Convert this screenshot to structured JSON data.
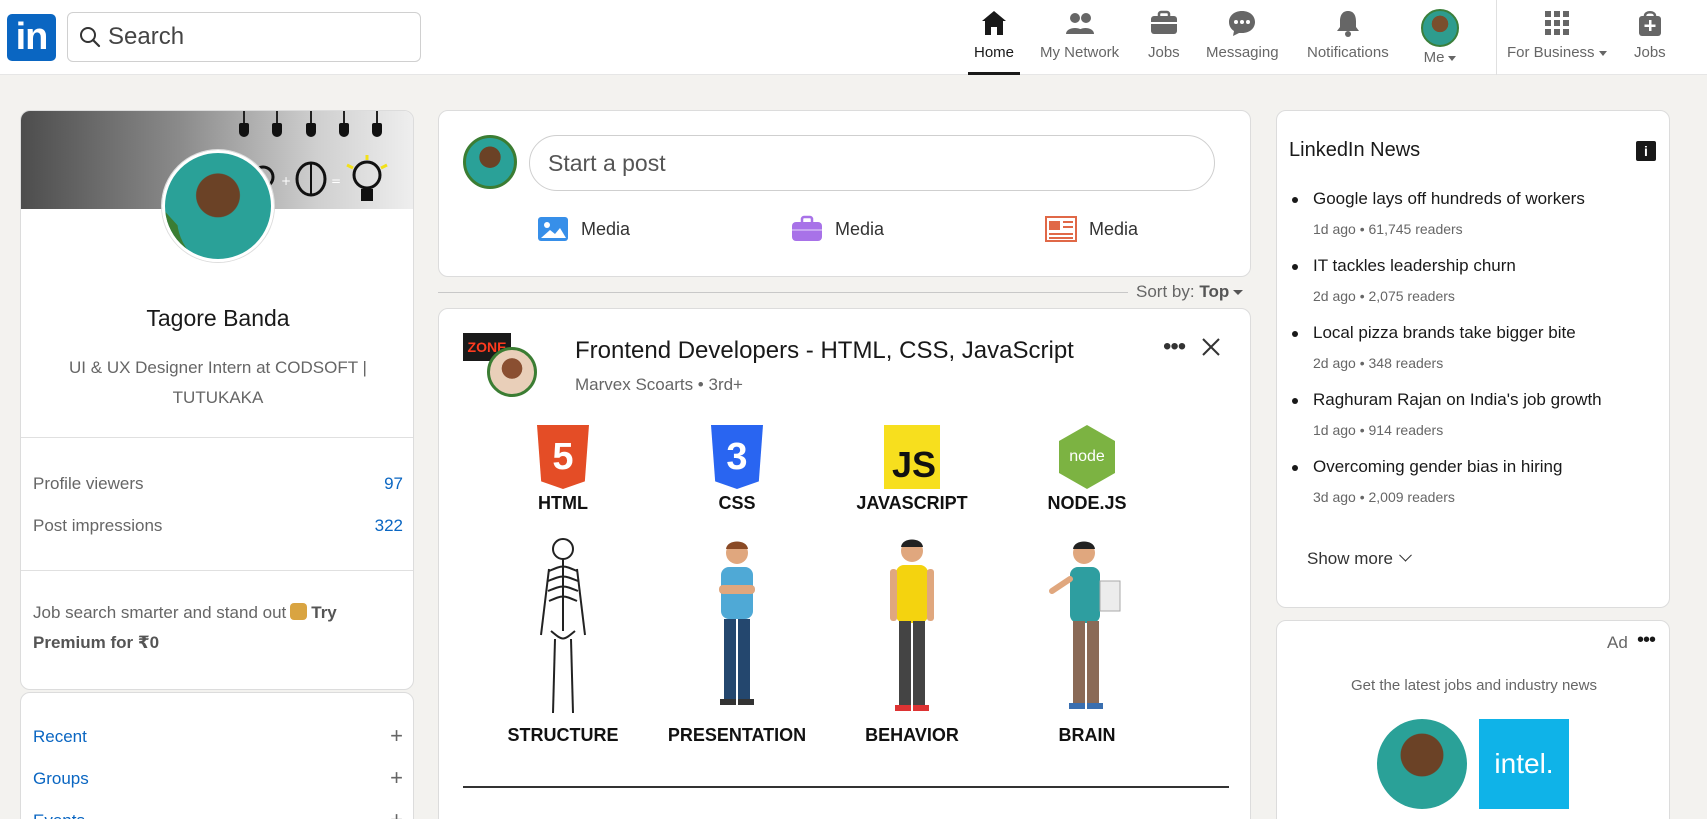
{
  "app": {
    "logo_text": "in"
  },
  "search": {
    "placeholder": "Search"
  },
  "nav": {
    "items": [
      {
        "label": "Home",
        "icon": "home-icon",
        "active": true
      },
      {
        "label": "My Network",
        "icon": "people-icon"
      },
      {
        "label": "Jobs",
        "icon": "briefcase-icon"
      },
      {
        "label": "Messaging",
        "icon": "chat-icon"
      },
      {
        "label": "Notifications",
        "icon": "bell-icon"
      },
      {
        "label": "Me",
        "icon": "avatar"
      },
      {
        "label": "For Business",
        "icon": "grid-icon"
      },
      {
        "label": "Jobs",
        "icon": "bag-plus-icon"
      }
    ]
  },
  "profile": {
    "name": "Tagore Banda",
    "headline": "UI & UX Designer Intern at CODSOFT | TUTUKAKA",
    "stats": [
      {
        "label": "Profile viewers",
        "value": "97"
      },
      {
        "label": "Post impressions",
        "value": "322"
      }
    ],
    "premium_text": "Job search smarter and stand out",
    "premium_cta": "Try Premium for ₹0",
    "links": [
      {
        "label": "Recent"
      },
      {
        "label": "Groups"
      },
      {
        "label": "Events"
      }
    ]
  },
  "composer": {
    "placeholder": "Start a post",
    "actions": [
      {
        "label": "Media",
        "icon": "image-icon",
        "color": "#378fe9"
      },
      {
        "label": "Media",
        "icon": "briefcase-icon",
        "color": "#a872e8"
      },
      {
        "label": "Media",
        "icon": "article-icon",
        "color": "#e06847"
      }
    ]
  },
  "feed": {
    "sort_label": "Sort by:",
    "sort_value": "Top",
    "post": {
      "group_logo_text": "ZONE",
      "title": "Frontend Developers - HTML, CSS, JavaScript",
      "subtitle": "Marvex Scoarts • 3rd+",
      "more": "•••",
      "techs": [
        {
          "name": "HTML",
          "badge": "5",
          "role": "STRUCTURE"
        },
        {
          "name": "CSS",
          "badge": "3",
          "role": "PRESENTATION"
        },
        {
          "name": "JAVASCRIPT",
          "badge": "JS",
          "role": "BEHAVIOR"
        },
        {
          "name": "NODE.JS",
          "badge": "node",
          "role": "BRAIN"
        }
      ]
    }
  },
  "news": {
    "title": "LinkedIn News",
    "info": "i",
    "items": [
      {
        "headline": "Google lays off hundreds of workers",
        "meta": "1d ago • 61,745 readers"
      },
      {
        "headline": "IT tackles leadership churn",
        "meta": "2d ago • 2,075 readers"
      },
      {
        "headline": "Local pizza brands take bigger bite",
        "meta": "2d ago • 348 readers"
      },
      {
        "headline": "Raghuram Rajan on India's job growth",
        "meta": "1d ago • 914 readers"
      },
      {
        "headline": "Overcoming gender bias in hiring",
        "meta": "3d ago • 2,009 readers"
      }
    ],
    "show_more": "Show more"
  },
  "ad": {
    "label": "Ad",
    "dots": "•••",
    "text": "Get the latest jobs and industry news",
    "brand": "intel."
  },
  "colors": {
    "brand": "#0a66c2",
    "background": "#f3f2ef"
  }
}
